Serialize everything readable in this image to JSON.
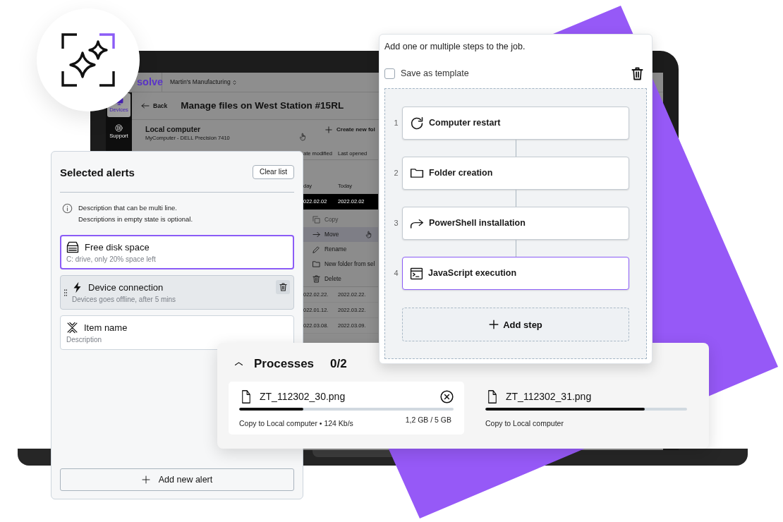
{
  "device_screen": {
    "brand": "solve",
    "organization": "Martin's Manufacturing",
    "nav": [
      {
        "kind": "devices",
        "label": "Devices",
        "selected": true
      },
      {
        "kind": "support",
        "label": "Support",
        "selected": false
      }
    ],
    "back_label": "Back",
    "title": "Manage files on West Station #15RL",
    "location": {
      "title": "Local computer",
      "subtitle": "MyComputer - DELL Precision 7410"
    },
    "create_button": "Create new fol",
    "columns": [
      "ate modified",
      "Last opened"
    ],
    "rows": [
      {
        "cells": [
          "day",
          "Today"
        ],
        "selected": false
      },
      {
        "cells": [
          "022.02.02",
          "2022.02.02"
        ],
        "selected": true
      },
      {
        "cells": [
          "022.02.22.",
          "2022.02.22."
        ],
        "selected": false
      },
      {
        "cells": [
          "022.01.12.",
          "2022.03.22."
        ],
        "selected": false
      },
      {
        "cells": [
          "022.03.08.",
          "2022.03.09."
        ],
        "selected": false
      }
    ],
    "context_menu": [
      {
        "kind": "copy",
        "label": "Copy",
        "disabled": true,
        "selected": false
      },
      {
        "kind": "move",
        "label": "Move",
        "disabled": false,
        "selected": true
      },
      {
        "kind": "rename",
        "label": "Rename",
        "disabled": false,
        "selected": false
      },
      {
        "kind": "folder",
        "label": "New folder from sel",
        "disabled": false,
        "selected": false
      },
      {
        "kind": "delete",
        "label": "Delete",
        "disabled": false,
        "selected": false
      }
    ]
  },
  "alerts_panel": {
    "title": "Selected alerts",
    "clear_button": "Clear list",
    "info_lines": [
      "Description that can be multi line.",
      "Descriptions in empty state is optional."
    ],
    "items": [
      {
        "kind": "disk",
        "title": "Free disk space",
        "description": "C: drive, only 20% space left",
        "selected": true,
        "hovered": false
      },
      {
        "kind": "connection",
        "title": "Device connection",
        "description": "Devices goes offline, after 5 mins",
        "selected": false,
        "hovered": true
      },
      {
        "kind": "custom",
        "title": "Item name",
        "description": "Description",
        "selected": false,
        "hovered": false
      }
    ],
    "add_button": "Add new alert"
  },
  "steps_panel": {
    "intro": "Add one or multiple steps to the job.",
    "save_template": {
      "label": "Save as template",
      "checked": false
    },
    "steps": [
      {
        "number": "1",
        "kind": "restart",
        "label": "Computer restart",
        "selected": false
      },
      {
        "number": "2",
        "kind": "folder",
        "label": "Folder creation",
        "selected": false
      },
      {
        "number": "3",
        "kind": "install",
        "label": "PowerShell installation",
        "selected": false
      },
      {
        "number": "4",
        "kind": "script",
        "label": "JavaScript execution",
        "selected": true
      }
    ],
    "add_button": "Add step"
  },
  "processes_panel": {
    "expanded": true,
    "title": "Processes",
    "count": "0/2",
    "items": [
      {
        "file": "ZT_112302_30.png",
        "level": 0.3,
        "status": "Copy to Local computer • 124 Kb/s",
        "size": "1,2 GB / 5 GB",
        "hovered": true
      },
      {
        "file": "ZT_112302_31.png",
        "level": 0.79,
        "status": "Copy to Local computer",
        "hovered": false
      }
    ]
  }
}
